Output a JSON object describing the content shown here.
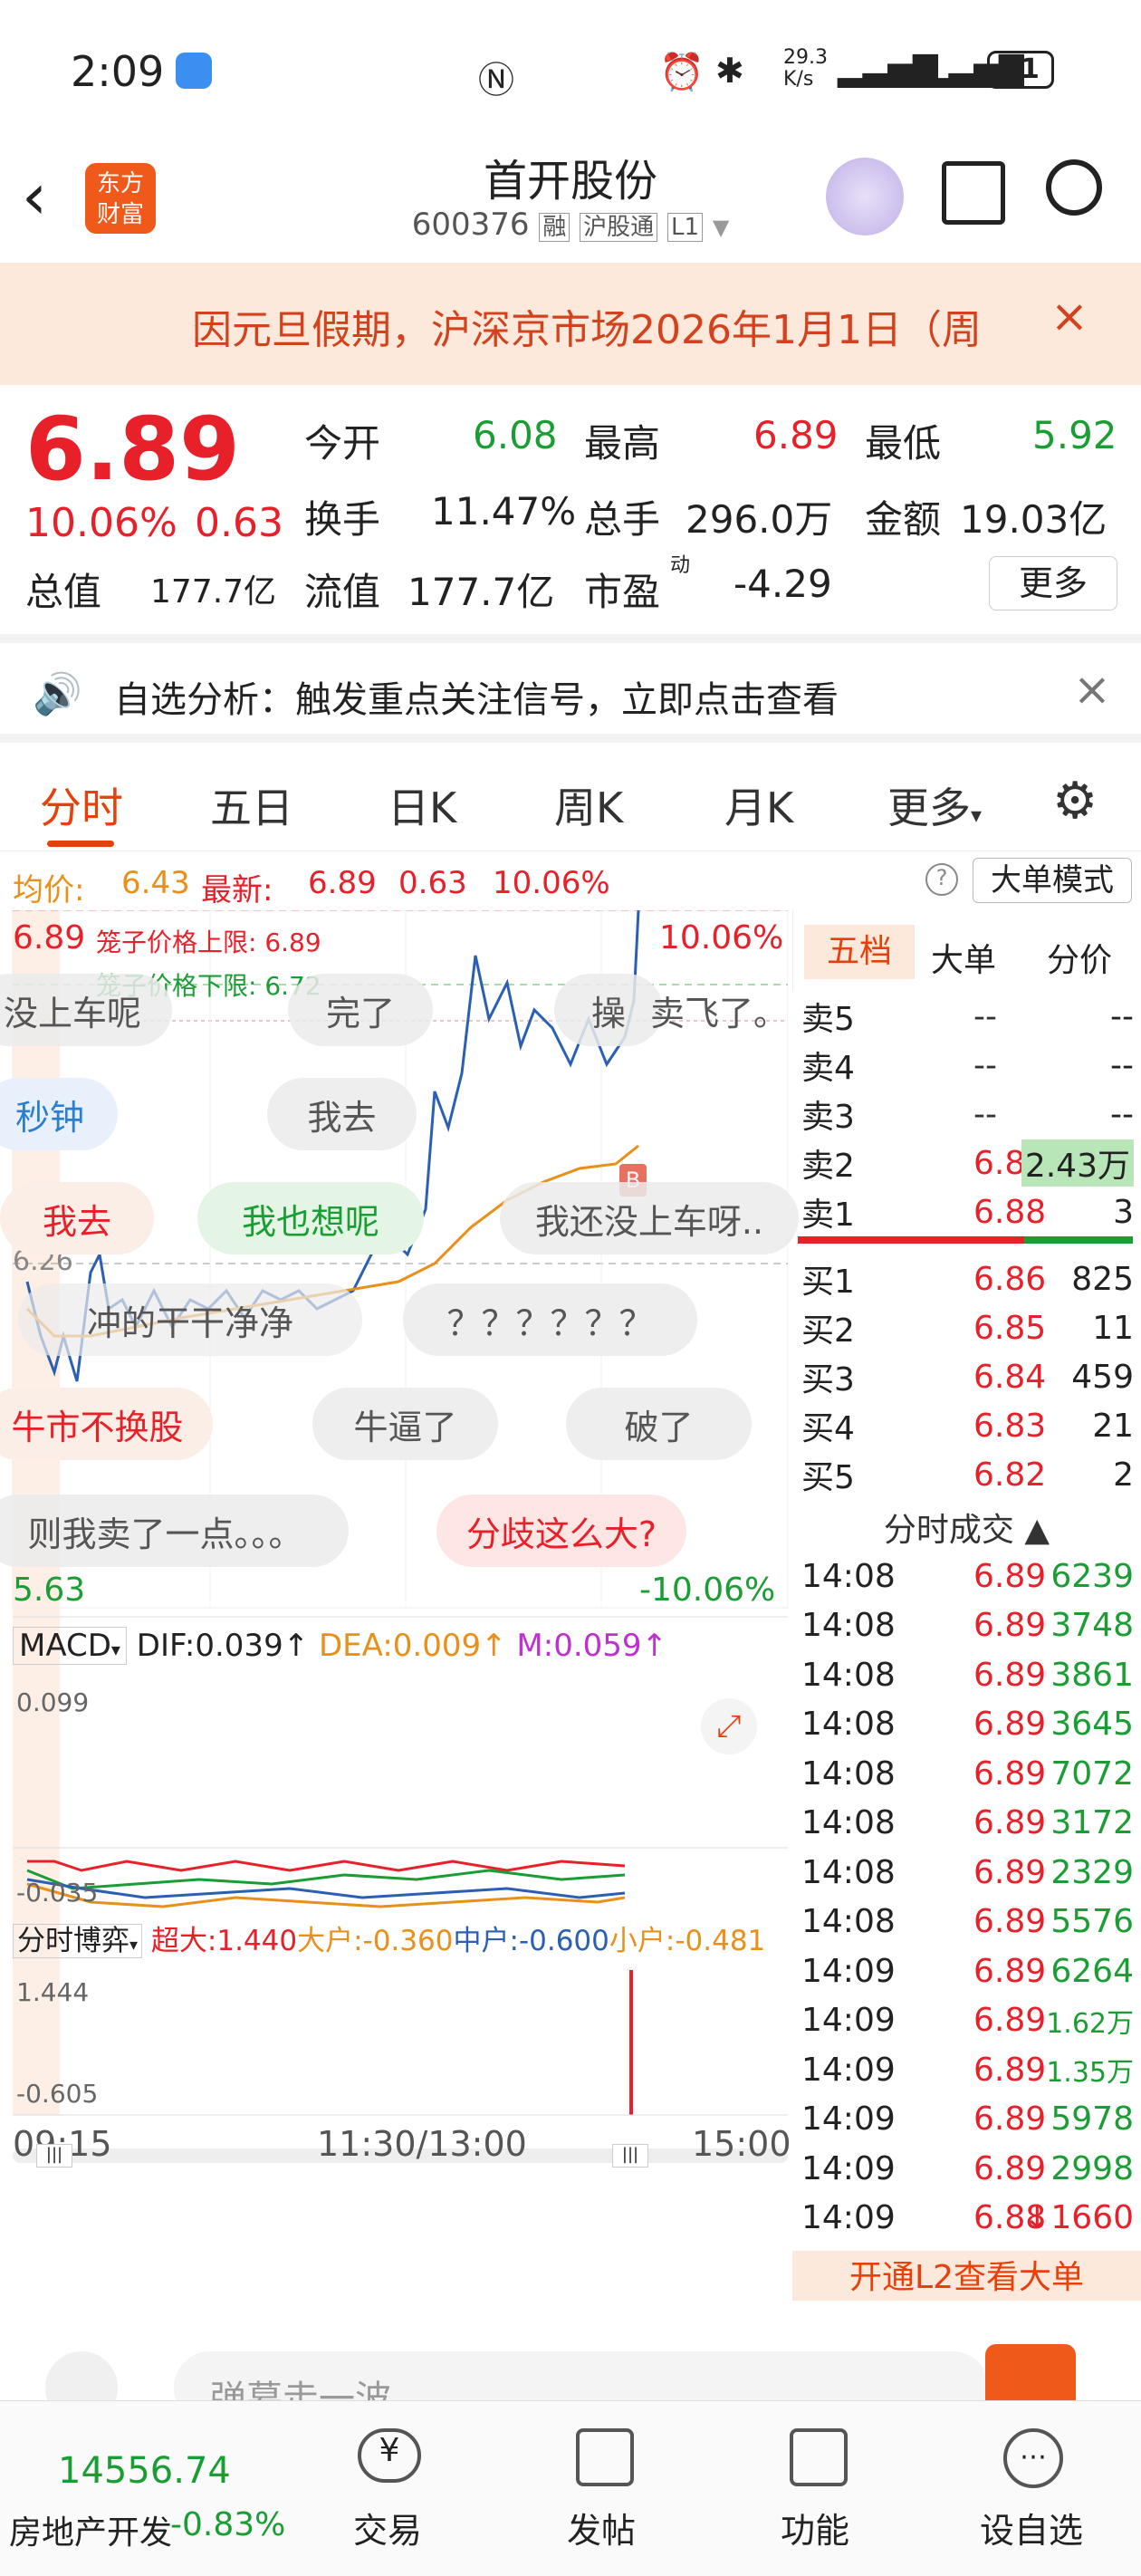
{
  "status": {
    "time": "2:09",
    "speed": "29.3\nK/s",
    "battery": "41"
  },
  "header": {
    "logo_line1": "东方",
    "logo_line2": "财富",
    "title": "首开股份",
    "code": "600376",
    "tags": [
      "融",
      "沪股通",
      "L1"
    ]
  },
  "notice": {
    "text": "因元旦假期，沪深京市场2026年1月1日（周"
  },
  "quote": {
    "price": "6.89",
    "pct": "10.06%",
    "chg": "0.63",
    "open_label": "今开",
    "open": "6.08",
    "high_label": "最高",
    "high": "6.89",
    "low_label": "最低",
    "low": "5.92",
    "turnover_label": "换手",
    "turnover": "11.47%",
    "volume_label": "总手",
    "volume": "296.0万",
    "amount_label": "金额",
    "amount": "19.03亿",
    "mktcap_label": "总值",
    "mktcap": "177.7亿",
    "float_label": "流值",
    "float": "177.7亿",
    "pe_label": "市盈",
    "pe_sup": "动",
    "pe": "-4.29",
    "more": "更多"
  },
  "alert": {
    "text": "自选分析：触发重点关注信号，立即点击查看"
  },
  "tabs": [
    "分时",
    "五日",
    "日K",
    "周K",
    "月K",
    "更多"
  ],
  "infobar": {
    "avg_label": "均价:",
    "avg": "6.43",
    "last_label": "最新:",
    "last": "6.89",
    "chg": "0.63",
    "pct": "10.06%",
    "mode": "大单模式"
  },
  "chart": {
    "top_price": "6.89",
    "top_pct": "10.06%",
    "upper_limit": "笼子价格上限: 6.89",
    "lower_limit": "笼子价格下限: 6.72",
    "prev_close": "6.26",
    "bottom_price": "5.63",
    "bottom_pct": "-10.06%",
    "macd": {
      "label": "MACD",
      "dif": "DIF:0.039↑",
      "dea": "DEA:0.009↑",
      "m": "M:0.059↑",
      "max": "0.099",
      "min": "-0.035"
    },
    "game": {
      "label": "分时博弈",
      "super": "超大:1.440",
      "big": "大户:-0.360",
      "mid": "中户:-0.600",
      "small": "小户:-0.481",
      "max": "1.444",
      "min": "-0.605"
    },
    "times": [
      "09:15",
      "11:30/13:00",
      "15:00"
    ],
    "marker": "B"
  },
  "danmaku": [
    "没上车呢",
    "完了",
    "操",
    "卖飞了。",
    "秒钟",
    "我去",
    "我去",
    "我也想呢",
    "我还没上车呀..",
    "冲的干干净净",
    "？？？？？？",
    "牛市不换股",
    "牛逼了",
    "破了",
    "则我卖了一点。。。",
    "分歧这么大?"
  ],
  "side": {
    "tabs": [
      "五档",
      "大单",
      "分价"
    ],
    "asks": [
      [
        "卖5",
        "--",
        "--"
      ],
      [
        "卖4",
        "--",
        "--"
      ],
      [
        "卖3",
        "--",
        "--"
      ],
      [
        "卖2",
        "6.89",
        "2.43万"
      ],
      [
        "卖1",
        "6.88",
        "3"
      ]
    ],
    "bids": [
      [
        "买1",
        "6.86",
        "825"
      ],
      [
        "买2",
        "6.85",
        "11"
      ],
      [
        "买3",
        "6.84",
        "459"
      ],
      [
        "买4",
        "6.83",
        "21"
      ],
      [
        "买5",
        "6.82",
        "2"
      ]
    ],
    "trades_title": "分时成交",
    "trades": [
      [
        "14:08",
        "6.89",
        "6239"
      ],
      [
        "14:08",
        "6.89",
        "3748"
      ],
      [
        "14:08",
        "6.89",
        "3861"
      ],
      [
        "14:08",
        "6.89",
        "3645"
      ],
      [
        "14:08",
        "6.89",
        "7072"
      ],
      [
        "14:08",
        "6.89",
        "3172"
      ],
      [
        "14:08",
        "6.89",
        "2329"
      ],
      [
        "14:08",
        "6.89",
        "5576"
      ],
      [
        "14:09",
        "6.89",
        "6264"
      ],
      [
        "14:09",
        "6.89",
        "1.62万"
      ],
      [
        "14:09",
        "6.89",
        "1.35万"
      ],
      [
        "14:09",
        "6.89",
        "5978"
      ],
      [
        "14:09",
        "6.89",
        "2998"
      ],
      [
        "14:09",
        "6.88",
        "↓1660"
      ]
    ],
    "l2": "开通L2查看大单"
  },
  "comment": {
    "placeholder": "弹幕走一波"
  },
  "bottom": {
    "index": "14556.74",
    "sector": "房地产开发",
    "sector_pct": "-0.83%",
    "items": [
      "交易",
      "发帖",
      "功能",
      "设自选"
    ]
  }
}
